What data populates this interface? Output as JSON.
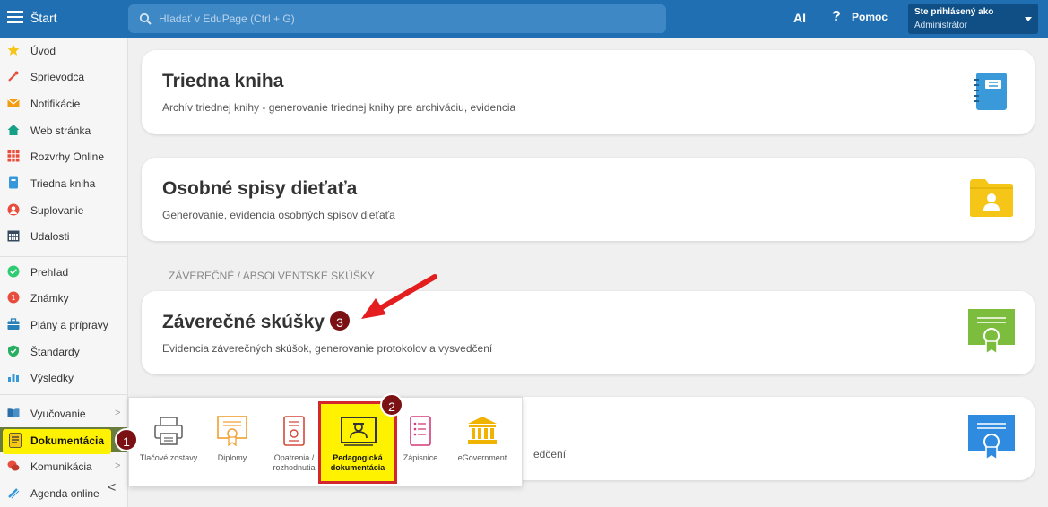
{
  "topbar": {
    "start_label": "Štart",
    "search_placeholder": "Hľadať v EduPage (Ctrl + G)",
    "ai_label": "AI",
    "help_label": "Pomoc",
    "user_line1": "Ste prihlásený ako",
    "user_line2": "Administrátor",
    "bg_color": "#1f6fb2"
  },
  "sidebar": {
    "items": [
      {
        "label": "Úvod",
        "icon": "star-icon",
        "color": "#f5c518"
      },
      {
        "label": "Sprievodca",
        "icon": "magic-wand-icon",
        "color": "#e74c3c"
      },
      {
        "label": "Notifikácie",
        "icon": "envelope-icon",
        "color": "#f39c12"
      },
      {
        "label": "Web stránka",
        "icon": "home-icon",
        "color": "#16a085"
      },
      {
        "label": "Rozvrhy Online",
        "icon": "grid-icon",
        "color": "#e74c3c"
      },
      {
        "label": "Triedna kniha",
        "icon": "book-icon",
        "color": "#3498db"
      },
      {
        "label": "Suplovanie",
        "icon": "person-icon",
        "color": "#e74c3c"
      },
      {
        "label": "Udalosti",
        "icon": "calendar-icon",
        "color": "#34495e"
      },
      {
        "label": "Prehľad",
        "icon": "check-circle-icon",
        "color": "#2ecc71"
      },
      {
        "label": "Známky",
        "icon": "grade-icon",
        "color": "#e74c3c"
      },
      {
        "label": "Plány a prípravy",
        "icon": "briefcase-icon",
        "color": "#2980b9"
      },
      {
        "label": "Štandardy",
        "icon": "shield-icon",
        "color": "#27ae60"
      },
      {
        "label": "Výsledky",
        "icon": "bar-chart-icon",
        "color": "#3498db"
      },
      {
        "label": "Vyučovanie",
        "icon": "open-book-icon",
        "color": "#2c6fa6"
      },
      {
        "label": "Dokumentácia",
        "icon": "document-icon",
        "color": "#f5c518"
      },
      {
        "label": "Komunikácia",
        "icon": "chat-icon",
        "color": "#e74c3c"
      },
      {
        "label": "Agenda online",
        "icon": "pen-icon",
        "color": "#3498db"
      }
    ]
  },
  "cards": [
    {
      "title": "Triedna kniha",
      "desc": "Archív triednej knihy - generovanie triednej knihy pre archiváciu, evidencia",
      "icon": "notebook-icon",
      "color": "#3a9ad9"
    },
    {
      "title": "Osobné spisy dieťaťa",
      "desc": "Generovanie, evidencia osobných spisov dieťaťa",
      "icon": "folder-person-icon",
      "color": "#f5c518"
    },
    {
      "title": "Záverečné skúšky",
      "desc": "Evidencia záverečných skúšok, generovanie protokolov a vysvedčení",
      "icon": "certificate-icon",
      "color": "#7cbd3e"
    },
    {
      "title": "",
      "desc": "edčení",
      "icon": "certificate-icon",
      "color": "#2f8be0"
    }
  ],
  "section_label": "ZÁVEREČNÉ / ABSOLVENTSKÉ SKÚŠKY",
  "panel": {
    "items": [
      {
        "label": "Tlačové zostavy",
        "icon": "printer-icon"
      },
      {
        "label": "Diplomy",
        "icon": "diploma-icon"
      },
      {
        "label": "Opatrenia / rozhodnutia",
        "icon": "decision-icon"
      },
      {
        "label": "Pedagogická dokumentácia",
        "icon": "pedagogical-doc-icon"
      },
      {
        "label": "Zápisnice",
        "icon": "list-icon"
      },
      {
        "label": "eGovernment",
        "icon": "bank-icon"
      }
    ]
  },
  "badges": [
    "1",
    "2",
    "3"
  ]
}
